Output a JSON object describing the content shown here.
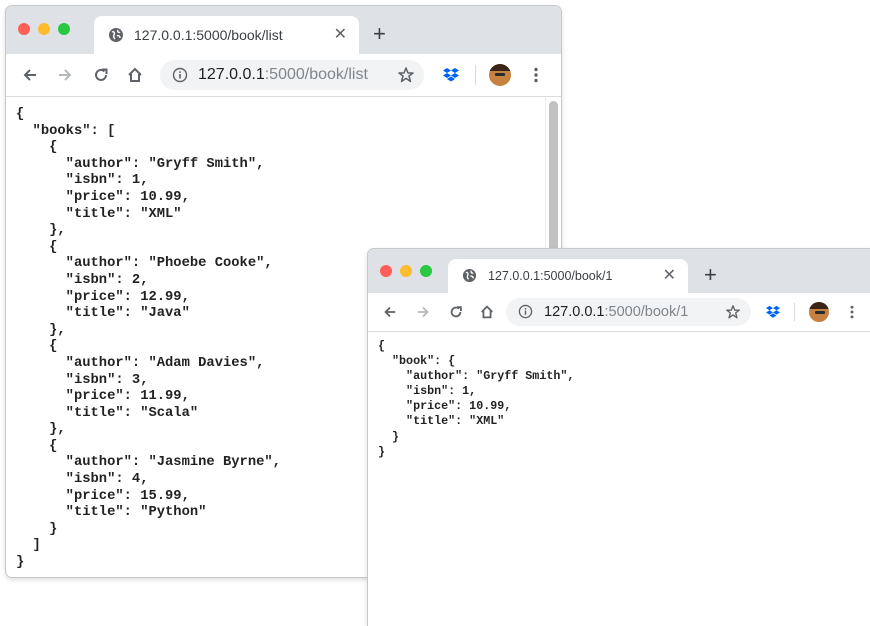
{
  "window1": {
    "tab_title": "127.0.0.1:5000/book/list",
    "url_host": "127.0.0.1",
    "url_path": ":5000/book/list",
    "json_body": "{\n  \"books\": [\n    {\n      \"author\": \"Gryff Smith\",\n      \"isbn\": 1,\n      \"price\": 10.99,\n      \"title\": \"XML\"\n    },\n    {\n      \"author\": \"Phoebe Cooke\",\n      \"isbn\": 2,\n      \"price\": 12.99,\n      \"title\": \"Java\"\n    },\n    {\n      \"author\": \"Adam Davies\",\n      \"isbn\": 3,\n      \"price\": 11.99,\n      \"title\": \"Scala\"\n    },\n    {\n      \"author\": \"Jasmine Byrne\",\n      \"isbn\": 4,\n      \"price\": 15.99,\n      \"title\": \"Python\"\n    }\n  ]\n}"
  },
  "window2": {
    "tab_title": "127.0.0.1:5000/book/1",
    "url_host": "127.0.0.1",
    "url_path": ":5000/book/1",
    "json_body": "{\n  \"book\": {\n    \"author\": \"Gryff Smith\",\n    \"isbn\": 1,\n    \"price\": 10.99,\n    \"title\": \"XML\"\n  }\n}"
  },
  "icons": {
    "tab_favicon": "globe-icon",
    "close": "close-icon",
    "new_tab": "plus-icon",
    "back": "back-arrow-icon",
    "forward": "forward-arrow-icon",
    "reload": "reload-icon",
    "home": "home-icon",
    "site_info": "info-icon",
    "bookmark": "star-icon",
    "extension": "dropbox-icon",
    "profile": "avatar",
    "menu": "kebab-menu-icon"
  },
  "symbols": {
    "close": "✕",
    "new_tab": "+"
  },
  "colors": {
    "tab_strip": "#dee1e6",
    "omnibox": "#f1f3f4",
    "traffic_red": "#ff5f57",
    "traffic_yellow": "#febc2e",
    "traffic_green": "#28c840",
    "dropbox_blue": "#0061fe"
  }
}
